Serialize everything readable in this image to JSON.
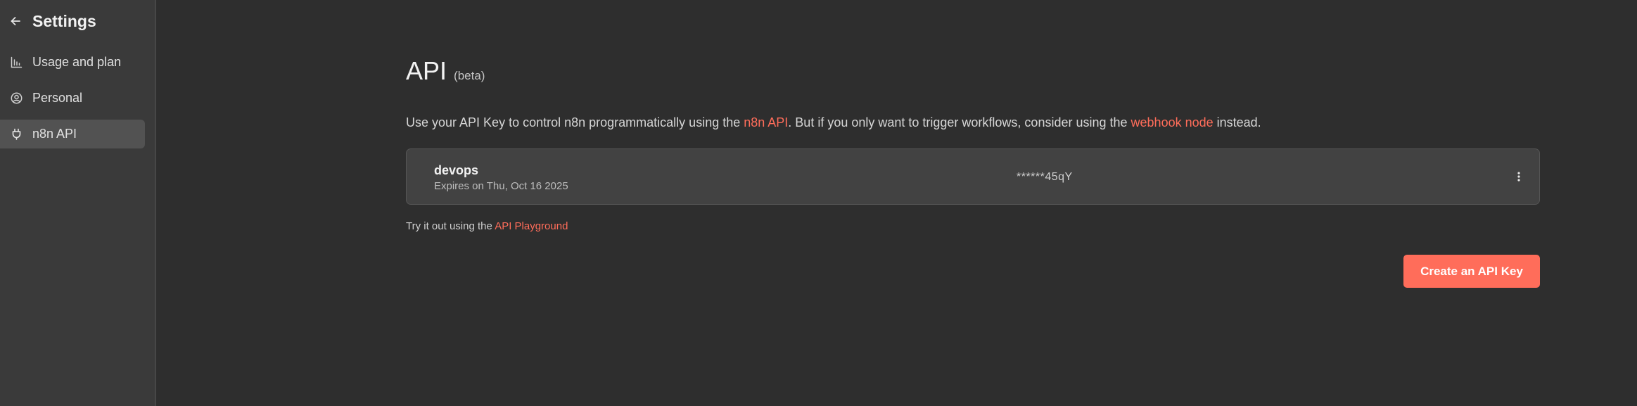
{
  "sidebar": {
    "title": "Settings",
    "back_icon": "arrow-left-icon",
    "items": [
      {
        "label": "Usage and plan",
        "icon": "chart-bar-icon",
        "active": false
      },
      {
        "label": "Personal",
        "icon": "user-circle-icon",
        "active": false
      },
      {
        "label": "n8n API",
        "icon": "plug-icon",
        "active": true
      }
    ]
  },
  "page": {
    "title": "API",
    "beta": "(beta)",
    "description": {
      "part1": "Use your API Key to control n8n programmatically using the ",
      "link1": "n8n API",
      "part2": ". But if you only want to trigger workflows, consider using the ",
      "link2": "webhook node",
      "part3": " instead."
    },
    "api_key": {
      "name": "devops",
      "expiry": "Expires on Thu, Oct 16 2025",
      "masked": "******45qY"
    },
    "tryout": {
      "text": "Try it out using the",
      "link": "API Playground"
    },
    "create_button": "Create an API Key"
  },
  "colors": {
    "accent": "#ff6d5a",
    "background": "#2e2e2e",
    "sidebar": "#3a3a3a",
    "active_item": "#525252",
    "card": "#424242"
  }
}
